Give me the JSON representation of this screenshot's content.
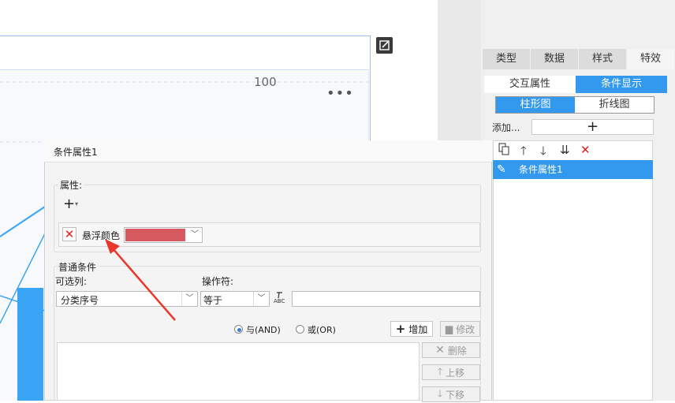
{
  "canvas": {
    "axis_value": "100",
    "more_icon": "•••"
  },
  "right_panel": {
    "tabs": [
      "类型",
      "数据",
      "样式",
      "特效"
    ],
    "active_tab": "特效",
    "sub_tabs": [
      "交互属性",
      "条件显示"
    ],
    "active_sub_tab": "条件显示",
    "chart_tabs": [
      "柱形图",
      "折线图"
    ],
    "active_chart_tab": "柱形图",
    "add_label": "添加...",
    "add_symbol": "+",
    "condition_items": [
      "条件属性1"
    ]
  },
  "dialog": {
    "title": "条件属性1",
    "attr_section_label": "属性:",
    "attr_add_symbol": "+",
    "attr_name": "悬浮颜色",
    "attr_color": "#d65a5f",
    "cond_section_label": "普通条件",
    "column_label": "可选列:",
    "column_value": "分类序号",
    "operator_label": "操作符:",
    "operator_value": "等于",
    "formula_icon_text": "ABC",
    "value_input": "",
    "radio_and": "与(AND)",
    "radio_or": "或(OR)",
    "add_button": "增加",
    "modify_button": "修改",
    "delete_button": "删除",
    "up_button": "上移",
    "down_button": "下移"
  },
  "colors": {
    "accent": "#3399ee",
    "bar": "#3aa5f4",
    "arrow": "#e8382d",
    "delete_red": "#e02020"
  }
}
